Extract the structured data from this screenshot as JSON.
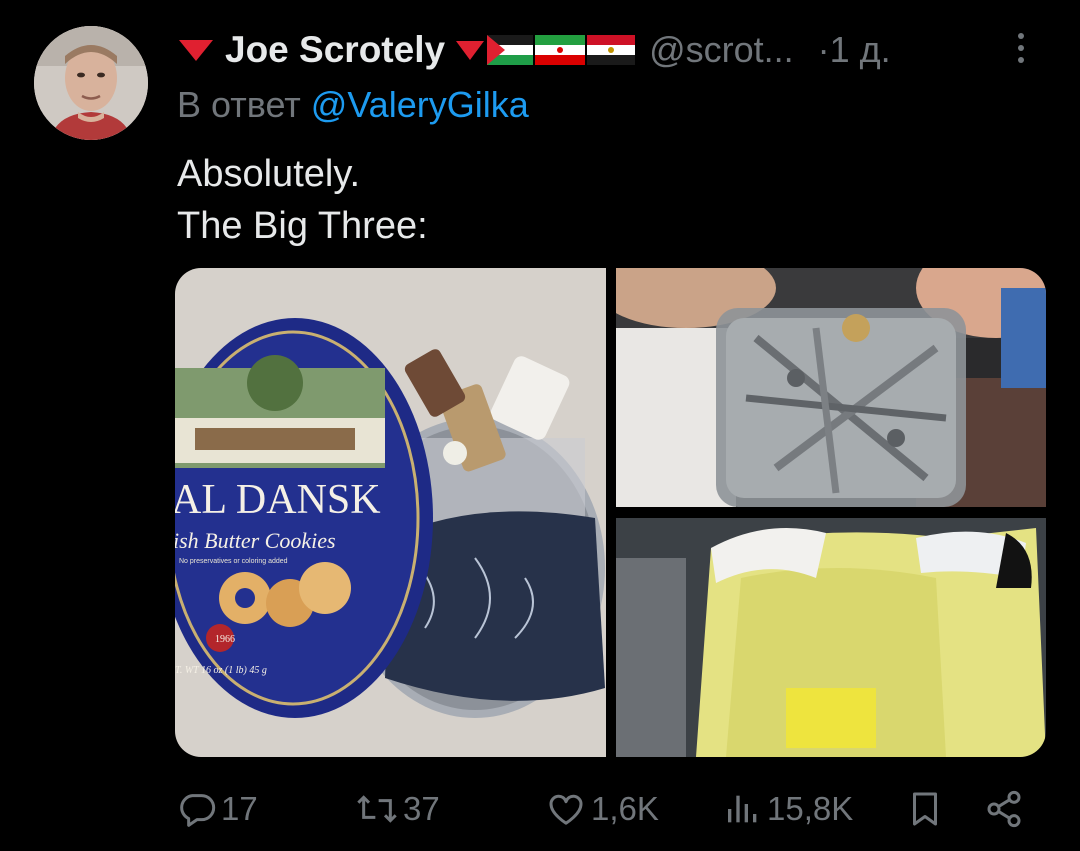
{
  "tweet": {
    "display_name": "Joe Scrotely",
    "handle": "@scrot...",
    "time": "·1 д.",
    "reply_prefix": "В ответ",
    "reply_mention": "@ValeryGilka",
    "text_lines": [
      "Absolutely.",
      "The Big Three:"
    ]
  },
  "media": {
    "photo1": {
      "tin_brand": "AL DANSK",
      "tin_subtitle": "ish Butter Cookies",
      "tin_note": "No preservatives or coloring added",
      "tin_seal": "1966",
      "tin_weight": "T. WT 16 oz (1 lb) 45 g"
    }
  },
  "actions": {
    "replies": "17",
    "reposts": "37",
    "likes": "1,6K",
    "views": "15,8K"
  },
  "colors": {
    "background": "#000000",
    "text": "#e7e9ea",
    "secondary": "#71767b",
    "link": "#1d9bf0",
    "flag_red": "#e02030"
  }
}
